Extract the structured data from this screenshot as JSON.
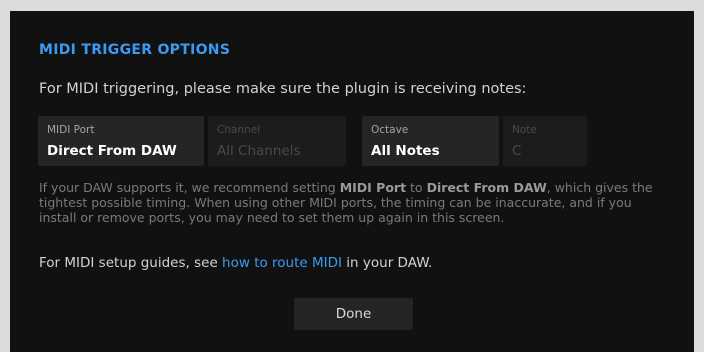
{
  "dialog": {
    "title": "MIDI TRIGGER OPTIONS",
    "intro": "For MIDI triggering, please make sure the plugin is receiving notes:"
  },
  "fields": {
    "midi_port": {
      "label": "MIDI Port",
      "value": "Direct From DAW"
    },
    "channel": {
      "label": "Channel",
      "value": "All Channels"
    },
    "octave": {
      "label": "Octave",
      "value": "All Notes"
    },
    "note": {
      "label": "Note",
      "value": "C"
    }
  },
  "note": {
    "part1": "If your DAW supports it, we recommend setting ",
    "bold1": "MIDI Port",
    "part2": " to ",
    "bold2": "Direct From DAW",
    "part3": ", which gives the tightest possible timing. When using other MIDI ports, the timing can be inaccurate, and if you install or remove ports, you may need to set them up again in this screen."
  },
  "guides": {
    "prefix": "For MIDI setup guides, see ",
    "link": "how to route MIDI",
    "suffix": " in your DAW."
  },
  "buttons": {
    "done": "Done"
  },
  "colors": {
    "accent": "#3a9bf2",
    "dialog_background": "#111111",
    "field_background": "#252525"
  }
}
